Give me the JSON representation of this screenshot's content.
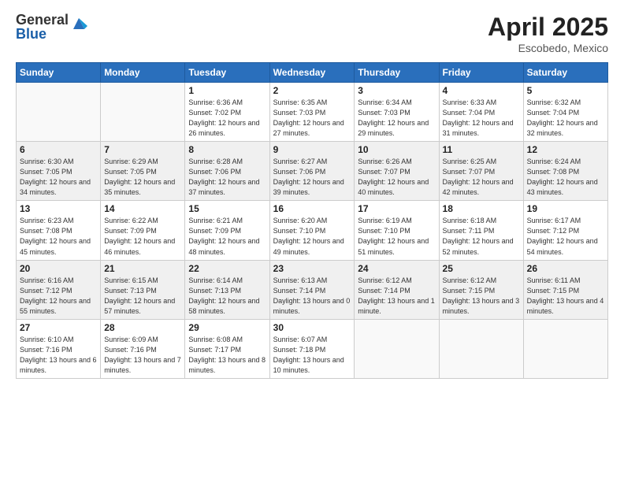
{
  "logo": {
    "general": "General",
    "blue": "Blue"
  },
  "title": {
    "month": "April 2025",
    "location": "Escobedo, Mexico"
  },
  "days_of_week": [
    "Sunday",
    "Monday",
    "Tuesday",
    "Wednesday",
    "Thursday",
    "Friday",
    "Saturday"
  ],
  "weeks": [
    [
      {
        "day": "",
        "info": ""
      },
      {
        "day": "",
        "info": ""
      },
      {
        "day": "1",
        "info": "Sunrise: 6:36 AM\nSunset: 7:02 PM\nDaylight: 12 hours and 26 minutes."
      },
      {
        "day": "2",
        "info": "Sunrise: 6:35 AM\nSunset: 7:03 PM\nDaylight: 12 hours and 27 minutes."
      },
      {
        "day": "3",
        "info": "Sunrise: 6:34 AM\nSunset: 7:03 PM\nDaylight: 12 hours and 29 minutes."
      },
      {
        "day": "4",
        "info": "Sunrise: 6:33 AM\nSunset: 7:04 PM\nDaylight: 12 hours and 31 minutes."
      },
      {
        "day": "5",
        "info": "Sunrise: 6:32 AM\nSunset: 7:04 PM\nDaylight: 12 hours and 32 minutes."
      }
    ],
    [
      {
        "day": "6",
        "info": "Sunrise: 6:30 AM\nSunset: 7:05 PM\nDaylight: 12 hours and 34 minutes."
      },
      {
        "day": "7",
        "info": "Sunrise: 6:29 AM\nSunset: 7:05 PM\nDaylight: 12 hours and 35 minutes."
      },
      {
        "day": "8",
        "info": "Sunrise: 6:28 AM\nSunset: 7:06 PM\nDaylight: 12 hours and 37 minutes."
      },
      {
        "day": "9",
        "info": "Sunrise: 6:27 AM\nSunset: 7:06 PM\nDaylight: 12 hours and 39 minutes."
      },
      {
        "day": "10",
        "info": "Sunrise: 6:26 AM\nSunset: 7:07 PM\nDaylight: 12 hours and 40 minutes."
      },
      {
        "day": "11",
        "info": "Sunrise: 6:25 AM\nSunset: 7:07 PM\nDaylight: 12 hours and 42 minutes."
      },
      {
        "day": "12",
        "info": "Sunrise: 6:24 AM\nSunset: 7:08 PM\nDaylight: 12 hours and 43 minutes."
      }
    ],
    [
      {
        "day": "13",
        "info": "Sunrise: 6:23 AM\nSunset: 7:08 PM\nDaylight: 12 hours and 45 minutes."
      },
      {
        "day": "14",
        "info": "Sunrise: 6:22 AM\nSunset: 7:09 PM\nDaylight: 12 hours and 46 minutes."
      },
      {
        "day": "15",
        "info": "Sunrise: 6:21 AM\nSunset: 7:09 PM\nDaylight: 12 hours and 48 minutes."
      },
      {
        "day": "16",
        "info": "Sunrise: 6:20 AM\nSunset: 7:10 PM\nDaylight: 12 hours and 49 minutes."
      },
      {
        "day": "17",
        "info": "Sunrise: 6:19 AM\nSunset: 7:10 PM\nDaylight: 12 hours and 51 minutes."
      },
      {
        "day": "18",
        "info": "Sunrise: 6:18 AM\nSunset: 7:11 PM\nDaylight: 12 hours and 52 minutes."
      },
      {
        "day": "19",
        "info": "Sunrise: 6:17 AM\nSunset: 7:12 PM\nDaylight: 12 hours and 54 minutes."
      }
    ],
    [
      {
        "day": "20",
        "info": "Sunrise: 6:16 AM\nSunset: 7:12 PM\nDaylight: 12 hours and 55 minutes."
      },
      {
        "day": "21",
        "info": "Sunrise: 6:15 AM\nSunset: 7:13 PM\nDaylight: 12 hours and 57 minutes."
      },
      {
        "day": "22",
        "info": "Sunrise: 6:14 AM\nSunset: 7:13 PM\nDaylight: 12 hours and 58 minutes."
      },
      {
        "day": "23",
        "info": "Sunrise: 6:13 AM\nSunset: 7:14 PM\nDaylight: 13 hours and 0 minutes."
      },
      {
        "day": "24",
        "info": "Sunrise: 6:12 AM\nSunset: 7:14 PM\nDaylight: 13 hours and 1 minute."
      },
      {
        "day": "25",
        "info": "Sunrise: 6:12 AM\nSunset: 7:15 PM\nDaylight: 13 hours and 3 minutes."
      },
      {
        "day": "26",
        "info": "Sunrise: 6:11 AM\nSunset: 7:15 PM\nDaylight: 13 hours and 4 minutes."
      }
    ],
    [
      {
        "day": "27",
        "info": "Sunrise: 6:10 AM\nSunset: 7:16 PM\nDaylight: 13 hours and 6 minutes."
      },
      {
        "day": "28",
        "info": "Sunrise: 6:09 AM\nSunset: 7:16 PM\nDaylight: 13 hours and 7 minutes."
      },
      {
        "day": "29",
        "info": "Sunrise: 6:08 AM\nSunset: 7:17 PM\nDaylight: 13 hours and 8 minutes."
      },
      {
        "day": "30",
        "info": "Sunrise: 6:07 AM\nSunset: 7:18 PM\nDaylight: 13 hours and 10 minutes."
      },
      {
        "day": "",
        "info": ""
      },
      {
        "day": "",
        "info": ""
      },
      {
        "day": "",
        "info": ""
      }
    ]
  ]
}
